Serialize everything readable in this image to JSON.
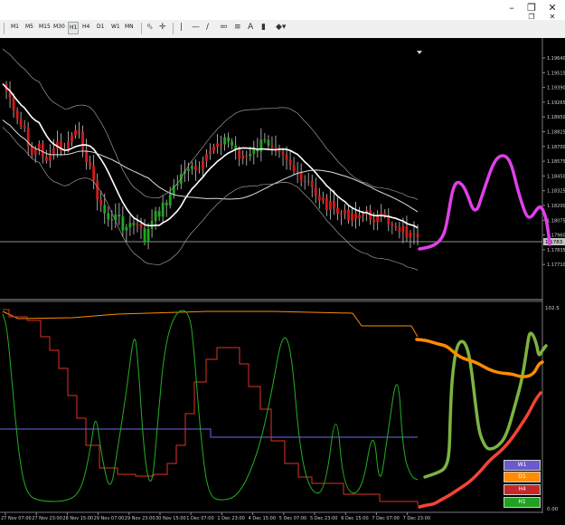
{
  "toolbar": {
    "timeframes": [
      "M1",
      "M5",
      "M15",
      "M30",
      "H1",
      "H4",
      "D1",
      "W1",
      "MN"
    ],
    "active_timeframe": "H1",
    "tools": [
      "cursor-icon",
      "crosshair-icon",
      "vertical-line-icon",
      "trendline-icon",
      "horizontal-line-icon",
      "text-label-icon",
      "fibonacci-icon",
      "shapes-icon"
    ]
  },
  "main_chart": {
    "price_labels": [
      "1.19640",
      "1.19515",
      "1.19390",
      "1.19265",
      "1.18950",
      "1.18825",
      "1.18700",
      "1.18575",
      "1.18450",
      "1.18325",
      "1.18200",
      "1.18075",
      "1.17960",
      "1.17835",
      "1.17710"
    ],
    "current_price": "1.1783"
  },
  "sub_chart": {
    "scale_top": "102.5",
    "scale_bottom": "0.00"
  },
  "time_axis": [
    "27 Nov 07:00",
    "27 Nov 23:00",
    "28 Nov 15:00",
    "29 Nov 07:00",
    "29 Nov 23:00",
    "30 Nov 15:00",
    "1 Dec 07:00",
    "1 Dec 23:00",
    "4 Dec 15:00",
    "5 Dec 07:00",
    "5 Dec 23:00",
    "6 Dec 15:00",
    "7 Dec 07:00",
    "7 Dec 23:00"
  ],
  "legend": [
    {
      "label": "W1",
      "color": "#6a5acd"
    },
    {
      "label": "D1",
      "color": "#ff8c00"
    },
    {
      "label": "H4",
      "color": "#c62828"
    },
    {
      "label": "H1",
      "color": "#22a022"
    }
  ],
  "colors": {
    "background": "#000000",
    "ma_white": "#ffffff",
    "candle_red": "#d41a1a",
    "candle_green": "#1ea81e",
    "magenta_drawing": "#e040e8",
    "green_drawing": "#7cb342",
    "orange_drawing": "#ff8c00",
    "red_drawing": "#f44336"
  }
}
